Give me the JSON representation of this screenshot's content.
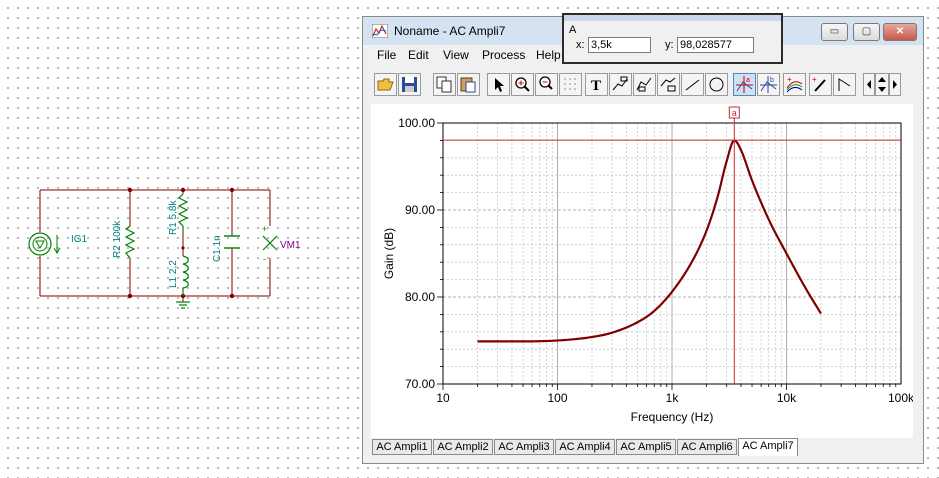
{
  "schematic": {
    "components": {
      "source": "IG1",
      "r2": "R2 100k",
      "r1": "R1 5,8k",
      "l1": "L1 2,2",
      "c1": "C1 1n",
      "meter": "VM1",
      "meter_plus": "+",
      "meter_minus": "-"
    },
    "colors": {
      "wire": "#800000",
      "component": "#008000",
      "label": "#008080",
      "meter_label": "#800080"
    }
  },
  "window": {
    "title": "Noname - AC Ampli7",
    "controls": {
      "minimize": "▭",
      "maximize": "▢",
      "close": "✕"
    },
    "menu": [
      "File",
      "Edit",
      "View",
      "Process",
      "Help"
    ],
    "toolbar": [
      "open-icon",
      "save-icon",
      "copy-icon",
      "paste-icon",
      "pointer-icon",
      "zoom-in-icon",
      "zoom-out-icon",
      "grid-icon",
      "text-icon",
      "label-icon",
      "label-icon",
      "label-icon",
      "line-icon",
      "ellipse-icon",
      "cursor-a-icon",
      "cursor-b-icon",
      "curve-icon",
      "marker-icon",
      "angle-icon",
      "scroll-left-icon",
      "scroll-updown-icon",
      "scroll-right-icon"
    ],
    "tabs": [
      "AC Ampli1",
      "AC Ampli2",
      "AC Ampli3",
      "AC Ampli4",
      "AC Ampli5",
      "AC Ampli6",
      "AC Ampli7"
    ],
    "active_tab": "AC Ampli7"
  },
  "cursor_popup": {
    "title": "A",
    "x_label": "x:",
    "x_value": "3,5k",
    "y_label": "y:",
    "y_value": "98,028577"
  },
  "chart_data": {
    "type": "line",
    "xlabel": "Frequency (Hz)",
    "ylabel": "Gain (dB)",
    "xscale": "log",
    "xlim": [
      10,
      100000
    ],
    "ylim": [
      70,
      100
    ],
    "x_ticks": [
      "10",
      "100",
      "1k",
      "10k",
      "100k"
    ],
    "y_ticks": [
      "70.00",
      "80.00",
      "90.00",
      "100.00"
    ],
    "grid": true,
    "line_color": "#800000",
    "cursor": {
      "label": "a",
      "x": 3500,
      "y": 98.028577
    },
    "series": [
      {
        "x": [
          20,
          50,
          100,
          200,
          300,
          500,
          700,
          1000,
          1500,
          2000,
          2500,
          3000,
          3500,
          4000,
          5000,
          7000,
          10000,
          15000,
          20000
        ],
        "y": [
          74.9,
          74.9,
          75.0,
          75.4,
          75.9,
          77.1,
          78.4,
          80.6,
          84.1,
          87.6,
          91.5,
          95.6,
          98.0,
          96.9,
          93.4,
          88.9,
          85.0,
          80.8,
          78.1
        ]
      }
    ]
  }
}
